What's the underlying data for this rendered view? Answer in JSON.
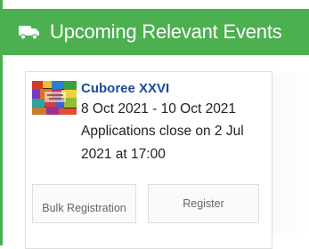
{
  "header": {
    "icon": "truck-icon",
    "title": "Upcoming Relevant Events",
    "color": "#4caf50"
  },
  "event": {
    "thumbnail": "event-thumbnail-image",
    "title": "Cuboree XXVI",
    "dates": "8 Oct 2021 - 10 Oct 2021",
    "applications_close": "Applications close on 2 Jul 2021 at 17:00",
    "title_color": "#1a4a9b"
  },
  "buttons": {
    "bulk_label": "Bulk Registration",
    "register_label": "Register"
  }
}
